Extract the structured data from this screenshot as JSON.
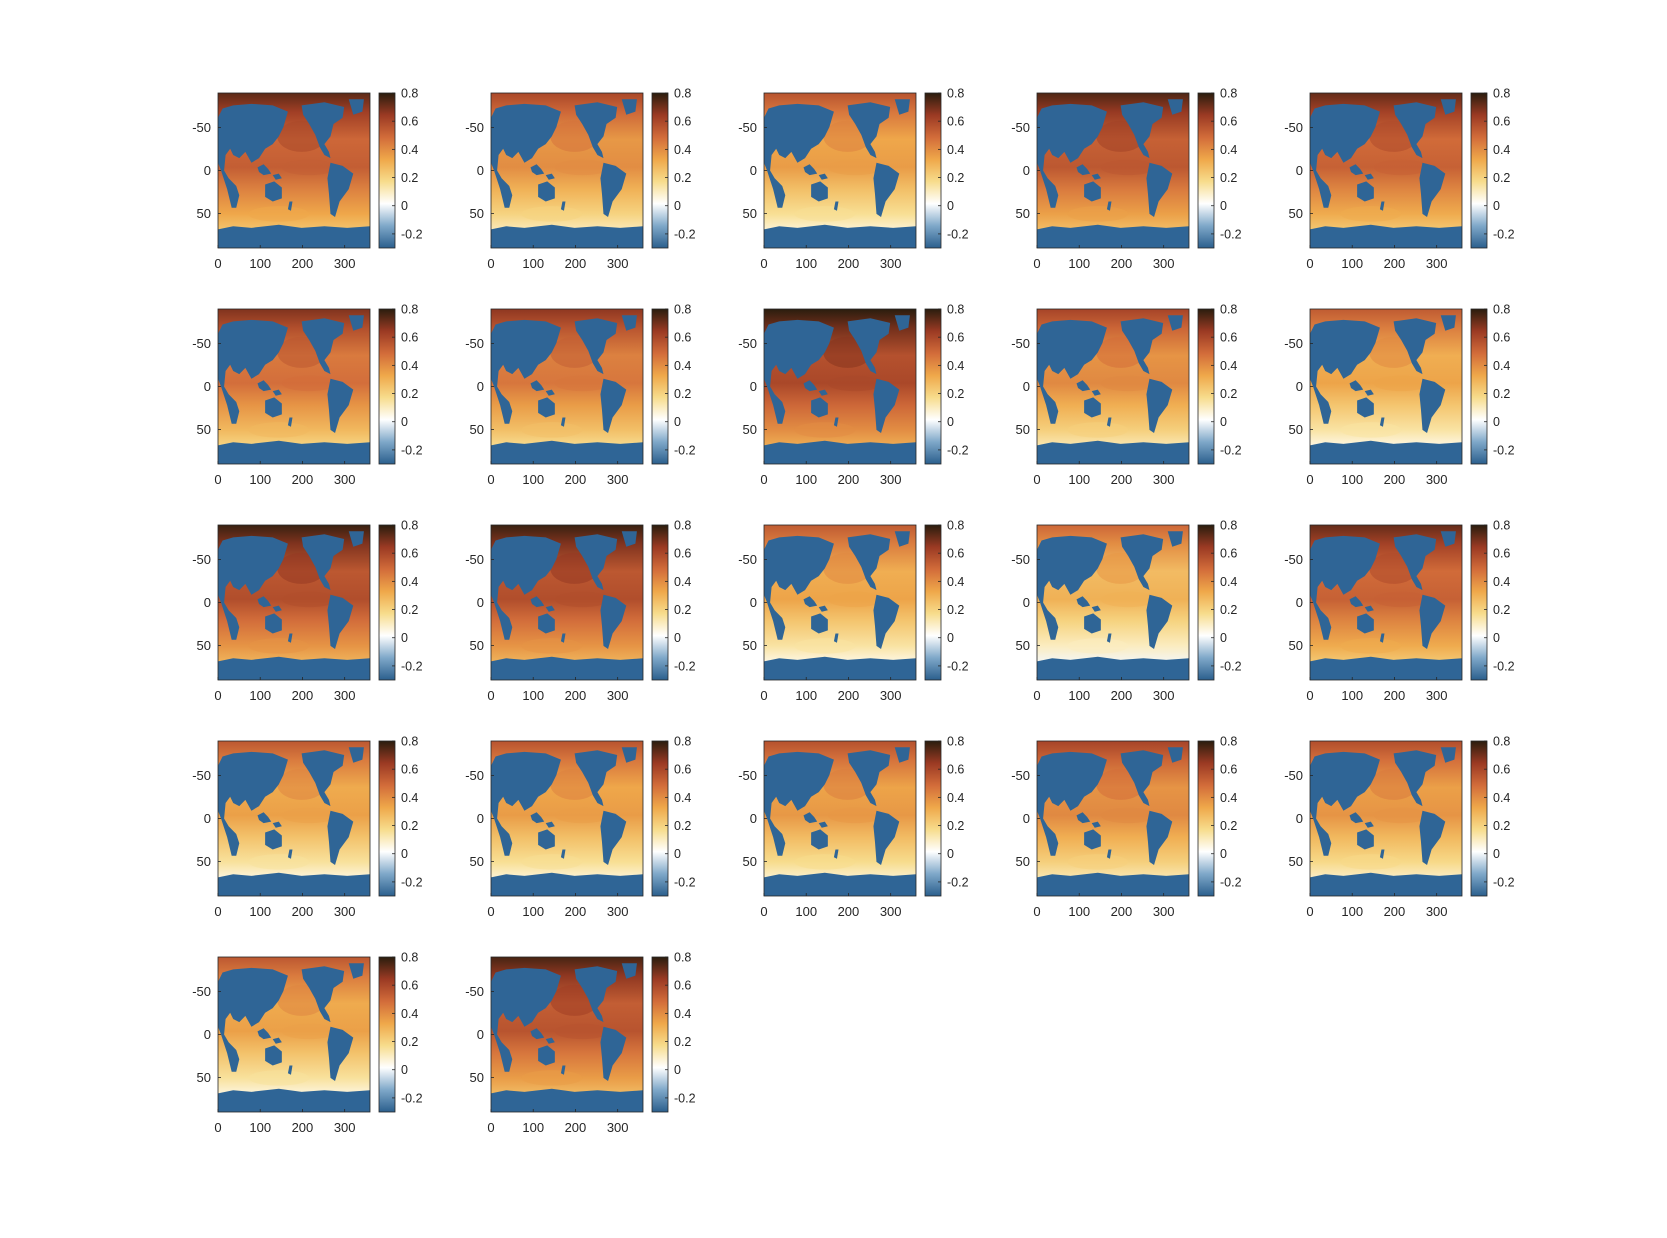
{
  "chart_data": {
    "type": "heatmap",
    "layout": {
      "rows": 5,
      "columns": 5,
      "panel_count": 22
    },
    "x_ticks": [
      0,
      100,
      200,
      300
    ],
    "x_tick_labels": [
      "0",
      "100",
      "200",
      "300"
    ],
    "xlim": [
      0,
      360
    ],
    "y_ticks": [
      -50,
      0,
      50
    ],
    "y_tick_labels": [
      "-50",
      "0",
      "50"
    ],
    "ylim": [
      -90,
      90
    ],
    "y_direction": "reversed",
    "colorbar": {
      "ticks": [
        0.8,
        0.6,
        0.4,
        0.2,
        0,
        -0.2
      ],
      "tick_labels": [
        "0.8",
        "0.6",
        "0.4",
        "0.2",
        "0",
        "-0.2"
      ],
      "range": [
        -0.3,
        0.8
      ],
      "colormap": [
        "#2b5f8d",
        "#7fa8c9",
        "#ffffff",
        "#f7dc8c",
        "#efa84a",
        "#d26c3a",
        "#9b3a23",
        "#2a1d0e"
      ]
    },
    "land_color": "#2f6596",
    "panels": [
      {
        "row": 1,
        "col": 1,
        "level": 0.45
      },
      {
        "row": 1,
        "col": 2,
        "level": 0.32
      },
      {
        "row": 1,
        "col": 3,
        "level": 0.28
      },
      {
        "row": 1,
        "col": 4,
        "level": 0.47
      },
      {
        "row": 1,
        "col": 5,
        "level": 0.44
      },
      {
        "row": 2,
        "col": 1,
        "level": 0.4
      },
      {
        "row": 2,
        "col": 2,
        "level": 0.38
      },
      {
        "row": 2,
        "col": 3,
        "level": 0.52
      },
      {
        "row": 2,
        "col": 4,
        "level": 0.33
      },
      {
        "row": 2,
        "col": 5,
        "level": 0.26
      },
      {
        "row": 3,
        "col": 1,
        "level": 0.5
      },
      {
        "row": 3,
        "col": 2,
        "level": 0.5
      },
      {
        "row": 3,
        "col": 3,
        "level": 0.26
      },
      {
        "row": 3,
        "col": 4,
        "level": 0.22
      },
      {
        "row": 3,
        "col": 5,
        "level": 0.44
      },
      {
        "row": 4,
        "col": 1,
        "level": 0.27
      },
      {
        "row": 4,
        "col": 2,
        "level": 0.28
      },
      {
        "row": 4,
        "col": 3,
        "level": 0.29
      },
      {
        "row": 4,
        "col": 4,
        "level": 0.33
      },
      {
        "row": 4,
        "col": 5,
        "level": 0.3
      },
      {
        "row": 5,
        "col": 1,
        "level": 0.27
      },
      {
        "row": 5,
        "col": 2,
        "level": 0.48
      }
    ]
  }
}
